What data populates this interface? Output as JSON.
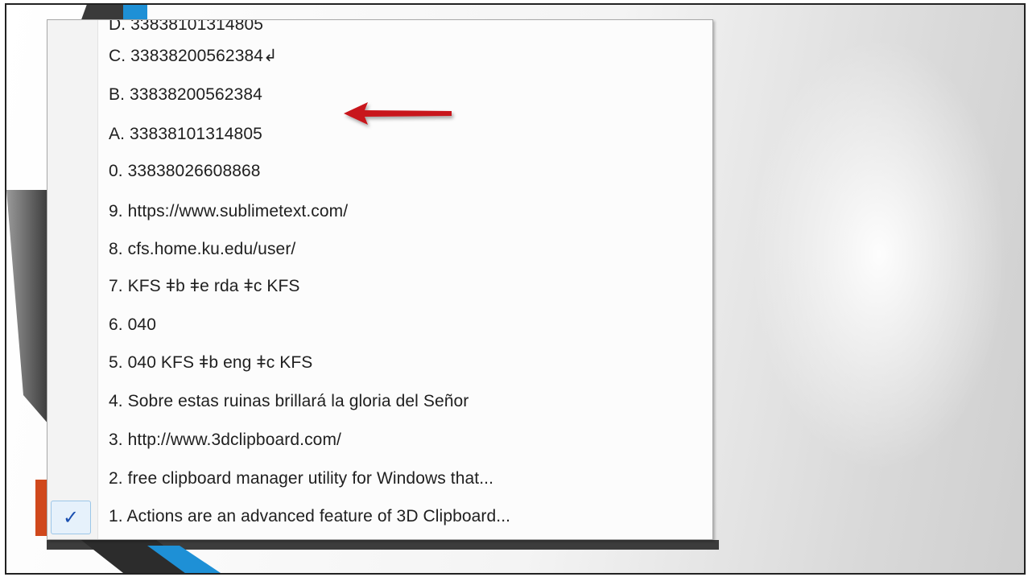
{
  "menu": {
    "partial_item": "D. 33838101314805",
    "items": [
      {
        "label": "C. 33838200562384↲"
      },
      {
        "label": "B. 33838200562384"
      },
      {
        "label": "A. 33838101314805"
      },
      {
        "label": "0. 33838026608868"
      },
      {
        "label": "9. https://www.sublimetext.com/"
      },
      {
        "label": "8.  cfs.home.ku.edu/user/"
      },
      {
        "label": "7. KFS ǂb  ǂe rda ǂc KFS"
      },
      {
        "label": "6. 040"
      },
      {
        "label": "5. 040  KFS ǂb eng ǂc KFS"
      },
      {
        "label": "4. Sobre estas ruinas brillará la gloria del Señor"
      },
      {
        "label": "3. http://www.3dclipboard.com/"
      },
      {
        "label": "2. free clipboard manager utility for Windows that..."
      },
      {
        "label": "1. Actions are an advanced feature of 3D Clipboard..."
      }
    ],
    "checked_item": "1. Actions are an advanced feature of 3D Clipboard...",
    "check_glyph": "✓"
  },
  "annotation": {
    "arrow_color": "#c8151b",
    "points_to": "B. 33838200562384",
    "icon": "red-arrow-icon"
  },
  "colors": {
    "accent_blue": "#1e90d6",
    "dark_shape": "#2c2c2c",
    "orange": "#d0481c"
  }
}
